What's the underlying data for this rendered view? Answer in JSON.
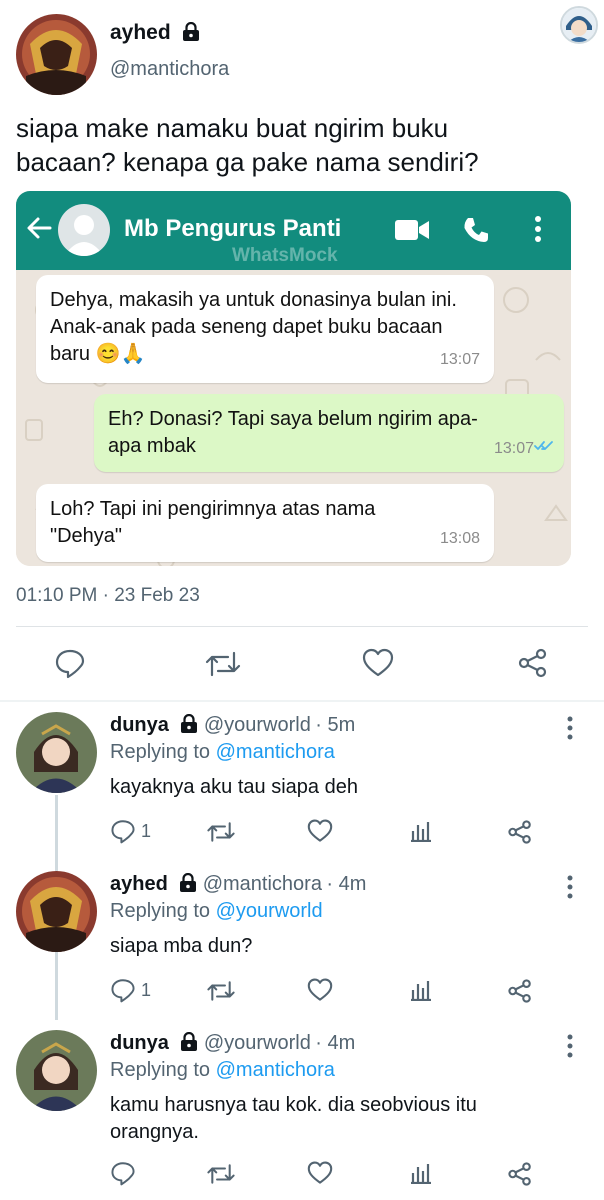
{
  "tweet": {
    "name": "ayhed",
    "handle": "@mantichora",
    "text": "siapa make namaku buat ngirim buku bacaan? kenapa ga pake nama sendiri?",
    "timestamp": "01:10 PM · 23 Feb 23"
  },
  "chat": {
    "contact": "Mb Pengurus Panti",
    "watermark": "WhatsMock",
    "messages": [
      {
        "direction": "in",
        "text": "Dehya, makasih ya untuk donasinya bulan ini. Anak-anak pada seneng dapet buku bacaan baru 😊🙏",
        "time": "13:07"
      },
      {
        "direction": "out",
        "text": "Eh? Donasi? Tapi saya belum ngirim apa-apa mbak",
        "time": "13:07"
      },
      {
        "direction": "in",
        "text": "Loh? Tapi ini pengirimnya atas nama \"Dehya\"",
        "time": "13:08"
      }
    ]
  },
  "replies": [
    {
      "name": "dunya",
      "handle": "@yourworld",
      "age": "· 5m",
      "replying_label": "Replying to",
      "replying_to": "@mantichora",
      "text": "kayaknya aku tau siapa deh",
      "reply_count": "1"
    },
    {
      "name": "ayhed",
      "handle": "@mantichora",
      "age": "· 4m",
      "replying_label": "Replying to",
      "replying_to": "@yourworld",
      "text": "siapa mba dun?",
      "reply_count": "1"
    },
    {
      "name": "dunya",
      "handle": "@yourworld",
      "age": "· 4m",
      "replying_label": "Replying to",
      "replying_to": "@mantichora",
      "text": "kamu harusnya tau kok. dia seobvious itu orangnya.",
      "reply_count": ""
    }
  ],
  "icons": {
    "lock": "lock-icon",
    "reply": "reply-icon",
    "retweet": "retweet-icon",
    "like": "heart-icon",
    "share": "share-icon",
    "views": "views-icon",
    "more": "more-icon"
  },
  "colors": {
    "whatsapp_header": "#128c7e",
    "outgoing_bubble": "#dcf8c6",
    "mention": "#1d9bf0",
    "muted": "#536471"
  }
}
